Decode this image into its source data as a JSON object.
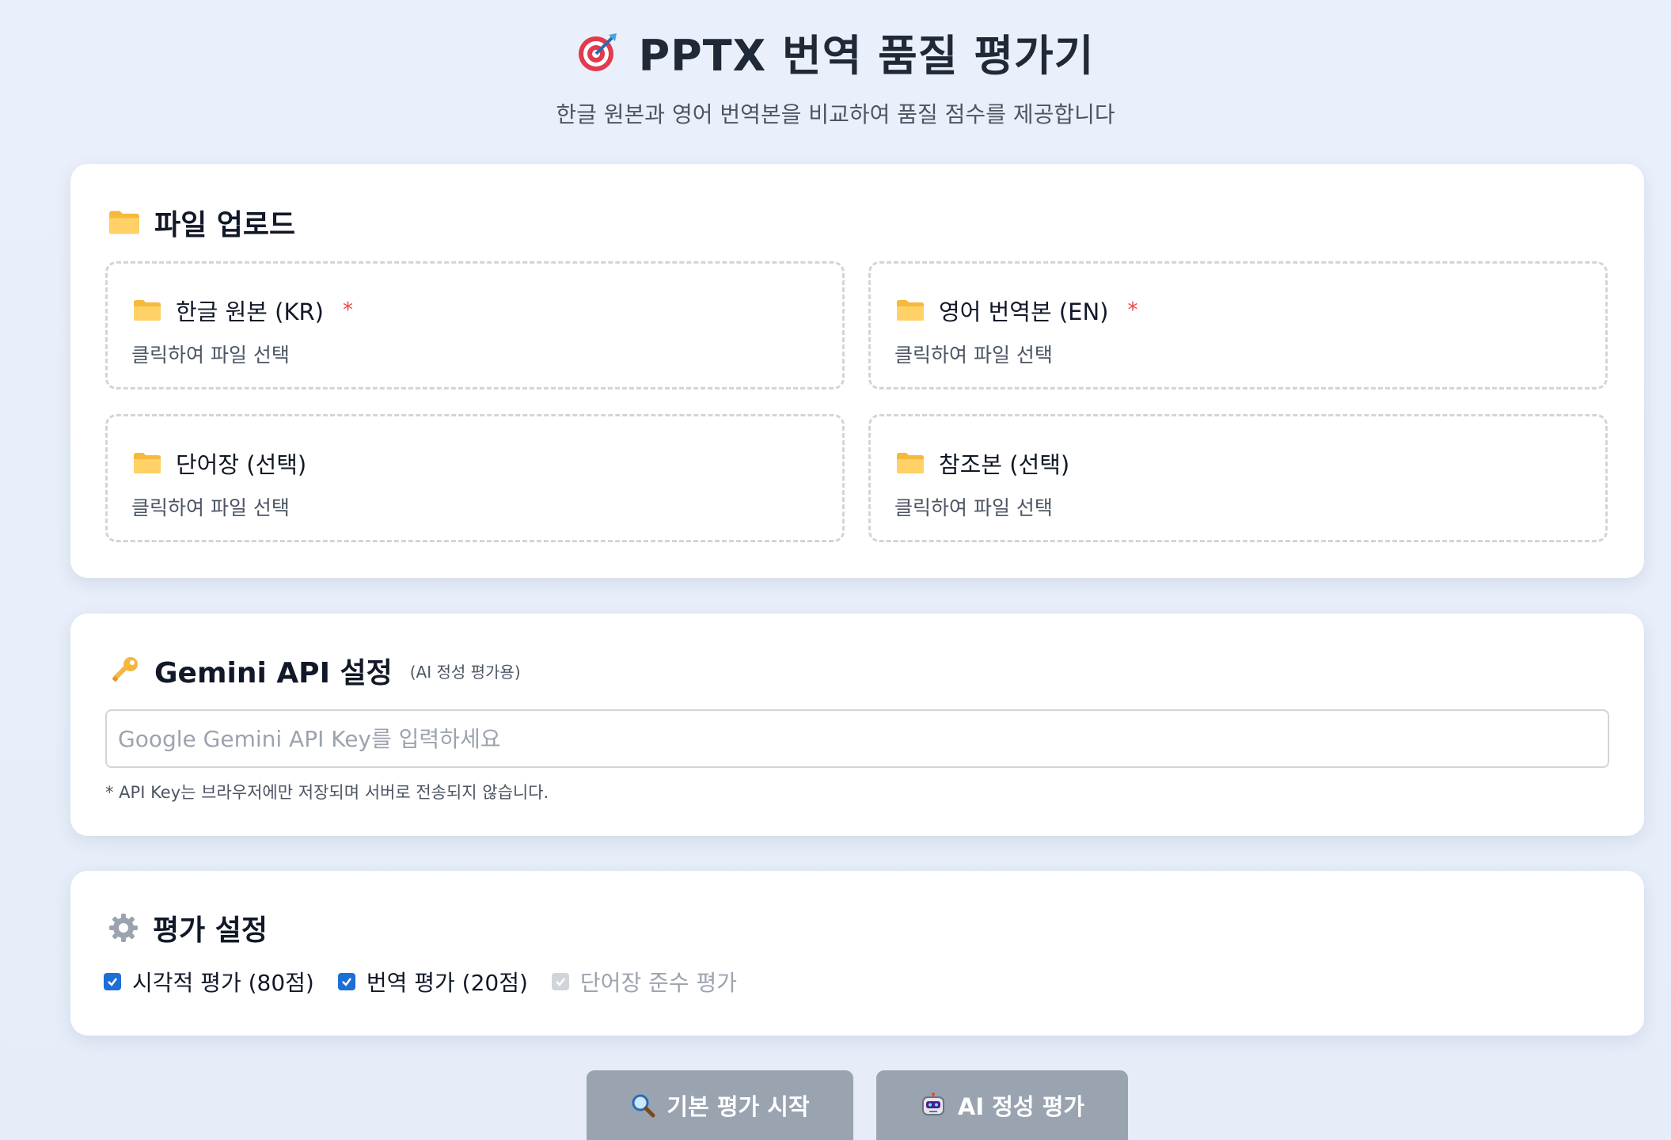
{
  "header": {
    "title": "PPTX 번역 품질 평가기",
    "subtitle": "한글 원본과 영어 번역본을 비교하여 품질 점수를 제공합니다",
    "icon": "target-icon"
  },
  "upload": {
    "title": "파일 업로드",
    "icon": "folder-icon",
    "items": [
      {
        "label": "한글 원본 (KR)",
        "required": "*",
        "hint": "클릭하여 파일 선택"
      },
      {
        "label": "영어 번역본 (EN)",
        "required": "*",
        "hint": "클릭하여 파일 선택"
      },
      {
        "label": "단어장 (선택)",
        "hint": "클릭하여 파일 선택"
      },
      {
        "label": "참조본 (선택)",
        "hint": "클릭하여 파일 선택"
      }
    ]
  },
  "api": {
    "title": "Gemini API 설정",
    "subtitle": "(AI 정성 평가용)",
    "icon": "key-icon",
    "placeholder": "Google Gemini API Key를 입력하세요",
    "value": "",
    "note": "* API Key는 브라우저에만 저장되며 서버로 전송되지 않습니다."
  },
  "evaluation": {
    "title": "평가 설정",
    "icon": "gear-icon",
    "options": [
      {
        "label": "시각적 평가 (80점)",
        "checked": true,
        "disabled": false
      },
      {
        "label": "번역 평가 (20점)",
        "checked": true,
        "disabled": false
      },
      {
        "label": "단어장 준수 평가",
        "checked": true,
        "disabled": true
      }
    ]
  },
  "buttons": {
    "basic": {
      "label": "기본 평가 시작",
      "icon": "magnifier-icon"
    },
    "ai": {
      "label": "AI 정성 평가",
      "icon": "robot-icon"
    }
  },
  "colors": {
    "accent": "#1d6fd8",
    "required": "#ef4444",
    "button_disabled": "#9aa3b0",
    "background": "#eaf0fb"
  }
}
